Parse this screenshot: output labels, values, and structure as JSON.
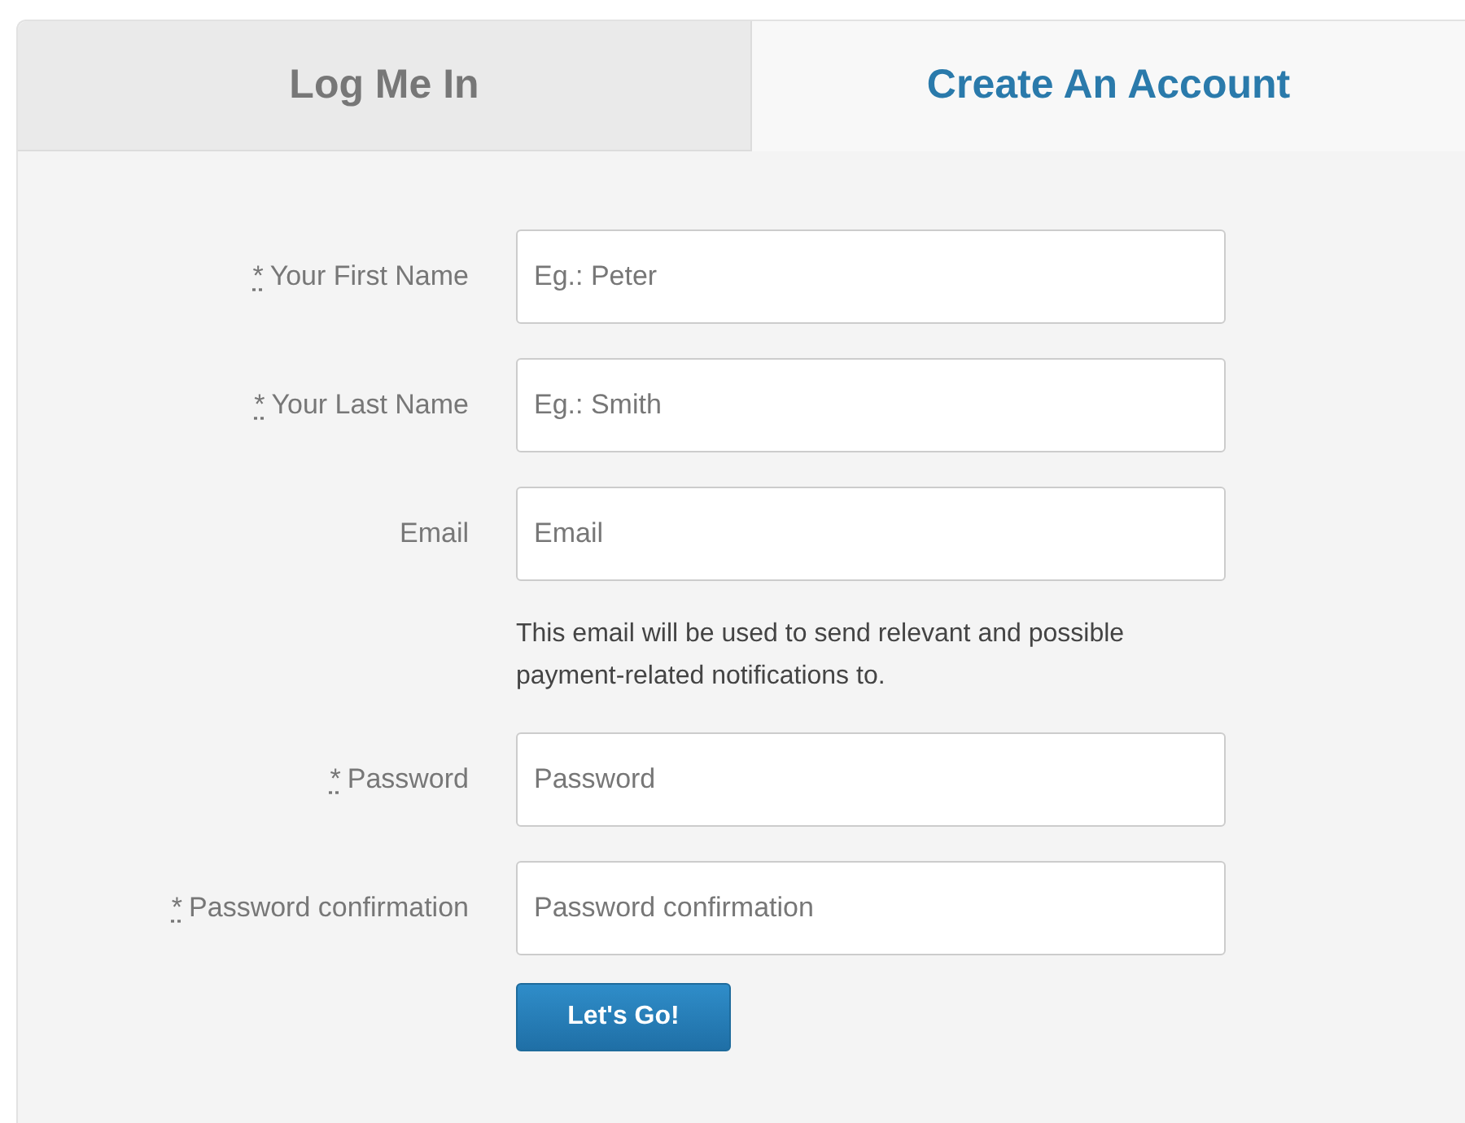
{
  "tabs": [
    {
      "label": "Log Me In",
      "selected": false
    },
    {
      "label": "Create An Account",
      "selected": true
    }
  ],
  "fields": [
    {
      "marker": "*",
      "label": "Your First Name",
      "placeholder": "Eg.: Peter"
    },
    {
      "marker": "*",
      "label": "Your Last Name",
      "placeholder": "Eg.: Smith"
    },
    {
      "label": "Email",
      "placeholder": "Email",
      "help": "This email will be used to send relevant and possible payment-related notifications to."
    },
    {
      "marker": "*",
      "label": "Password",
      "placeholder": "Password"
    },
    {
      "marker": "*",
      "label": "Password confirmation",
      "placeholder": "Password confirmation"
    }
  ],
  "submit": {
    "label": "Let's Go!"
  }
}
